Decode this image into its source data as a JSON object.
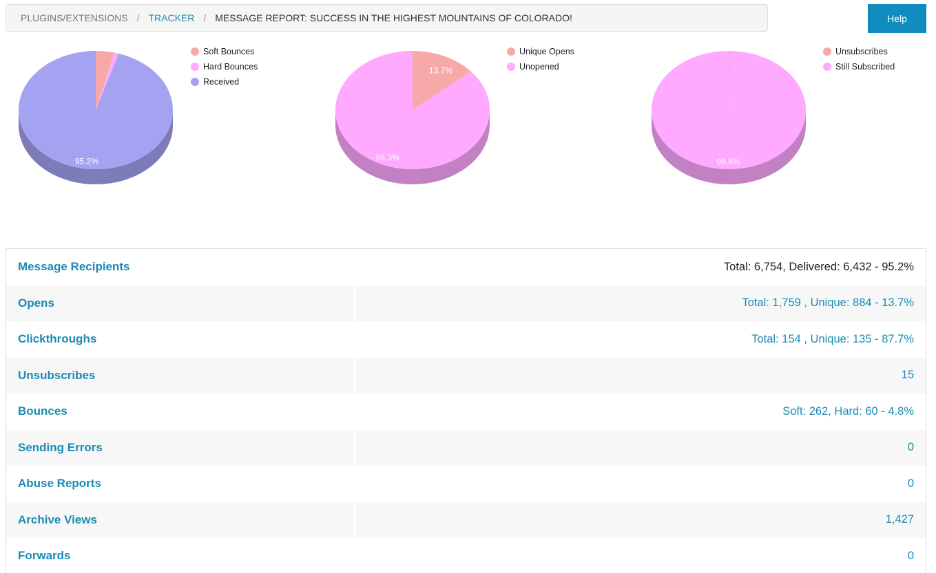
{
  "breadcrumb": {
    "items": [
      "PLUGINS/EXTENSIONS",
      "TRACKER",
      "MESSAGE REPORT: SUCCESS IN THE HIGHEST MOUNTAINS OF COLORADO!"
    ],
    "separator": "/"
  },
  "header": {
    "help_label": "Help"
  },
  "chart_data": [
    {
      "type": "pie",
      "slices": [
        {
          "label": "Soft Bounces",
          "value": 3.9,
          "color": "#f7a8a8"
        },
        {
          "label": "Hard Bounces",
          "value": 0.9,
          "color": "#ffaaff"
        },
        {
          "label": "Received",
          "value": 95.2,
          "color": "#a5a2f2"
        }
      ],
      "data_labels": [
        "",
        "",
        "95.2%"
      ],
      "legend_position": "right"
    },
    {
      "type": "pie",
      "slices": [
        {
          "label": "Unique Opens",
          "value": 13.7,
          "color": "#f7a8a8"
        },
        {
          "label": "Unopened",
          "value": 86.3,
          "color": "#ffaaff"
        }
      ],
      "data_labels": [
        "13.7%",
        "86.3%"
      ],
      "legend_position": "right"
    },
    {
      "type": "pie",
      "slices": [
        {
          "label": "Unsubscribes",
          "value": 0.2,
          "color": "#f7a8a8"
        },
        {
          "label": "Still Subscribed",
          "value": 99.8,
          "color": "#ffaaff"
        }
      ],
      "data_labels": [
        "",
        "99.8%"
      ],
      "legend_position": "right"
    }
  ],
  "stats": {
    "rows": [
      {
        "label": "Message Recipients",
        "value": "Total: 6,754, Delivered: 6,432 - 95.2%"
      },
      {
        "label": "Opens",
        "value": "Total: 1,759 , Unique: 884 - 13.7%"
      },
      {
        "label": "Clickthroughs",
        "value": "Total: 154 , Unique: 135 - 87.7%"
      },
      {
        "label": "Unsubscribes",
        "value": "15"
      },
      {
        "label": "Bounces",
        "value": "Soft: 262, Hard: 60 - 4.8%"
      },
      {
        "label": "Sending Errors",
        "value": "0"
      },
      {
        "label": "Abuse Reports",
        "value": "0"
      },
      {
        "label": "Archive Views",
        "value": "1,427"
      },
      {
        "label": "Forwards",
        "value": "0"
      }
    ]
  }
}
